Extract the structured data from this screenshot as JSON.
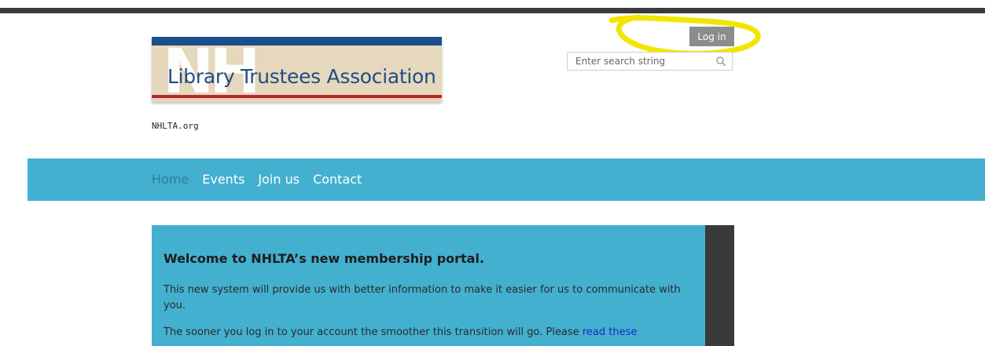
{
  "header": {
    "logo_monogram": "NH",
    "logo_org_name": "Library Trustees Association",
    "site_tag": "NHLTA.org",
    "login_label": "Log in",
    "search_placeholder": "Enter search string",
    "highlight_color": "#f2e600"
  },
  "nav": {
    "items": [
      {
        "label": "Home",
        "active": true
      },
      {
        "label": "Events"
      },
      {
        "label": "Join us"
      },
      {
        "label": "Contact"
      }
    ]
  },
  "welcome": {
    "title": "Welcome to NHLTA’s new membership portal.",
    "paragraph1": "This new system will provide us with better information to make it easier for us to communicate with you.",
    "paragraph2_text": "The sooner you log in to your account the smoother this transition will go. Please ",
    "paragraph2_link": "read these"
  },
  "colors": {
    "nav_bg": "#43b0cf",
    "top_bar": "#3b3b3b",
    "login_bg": "#8c8c8c",
    "link": "#1b27c8"
  }
}
